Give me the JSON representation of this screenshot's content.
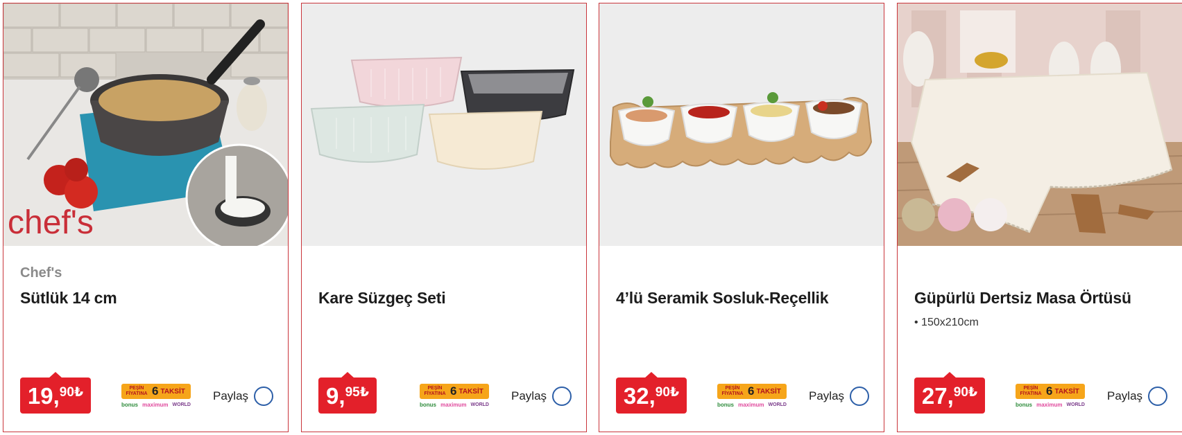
{
  "currency_symbol": "₺",
  "share_label": "Paylaş",
  "installment_badge": {
    "small_text": "PEŞİN FİYATINA",
    "count": "6",
    "word": "TAKSİT",
    "card_1": "bonus",
    "card_2": "maximum",
    "card_3": "WORLD"
  },
  "products": [
    {
      "brand": "Chef's",
      "image_text": "chef's",
      "title": "Sütlük 14 cm",
      "spec": "",
      "price_int": "19,",
      "price_dec": "90"
    },
    {
      "brand": "",
      "title": "Kare Süzgeç Seti",
      "spec": "",
      "price_int": "9,",
      "price_dec": "95"
    },
    {
      "brand": "",
      "title": "4’lü Seramik Sosluk-Reçellik",
      "spec": "",
      "price_int": "32,",
      "price_dec": "90"
    },
    {
      "brand": "",
      "title": "Güpürlü Dertsiz Masa Örtüsü",
      "spec": "• 150x210cm",
      "price_int": "27,",
      "price_dec": "90"
    }
  ],
  "colors": {
    "accent_red": "#e3202a",
    "card_border": "#c9343a",
    "badge_orange": "#f6a51a",
    "share_blue": "#2d5fa8"
  }
}
